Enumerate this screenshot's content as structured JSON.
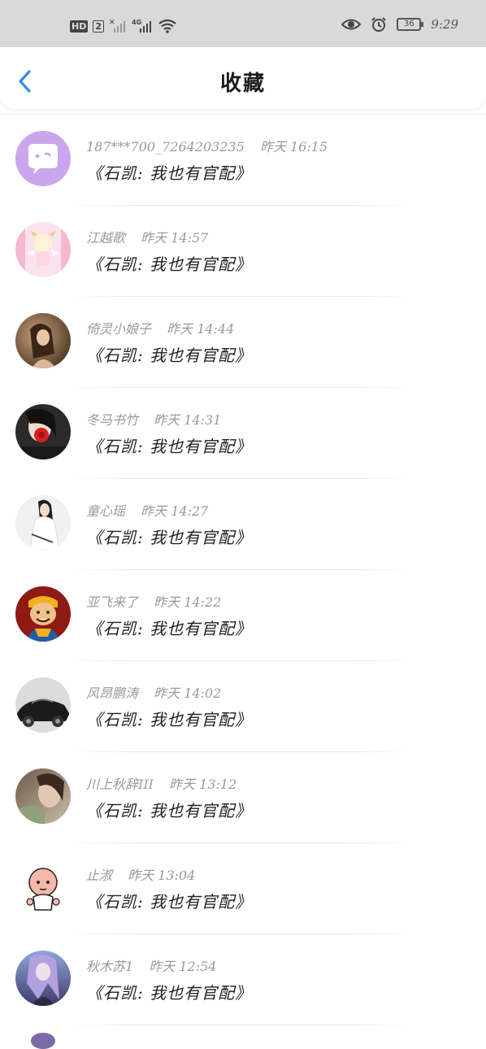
{
  "status_bar": {
    "hd_label": "HD",
    "sim_label": "2",
    "network_label": "4G",
    "battery_label": "36",
    "time": "9:29"
  },
  "header": {
    "back_icon": "chevron-left-icon",
    "title": "收藏",
    "accent_color": "#2e8ee6"
  },
  "favorites": [
    {
      "name": "187***700_7264203235",
      "time": "昨天 16:15",
      "title": "《石凯: 我也有官配》",
      "avatar": "purple-chat-bubble"
    },
    {
      "name": "江越歌",
      "time": "昨天 14:57",
      "title": "《石凯: 我也有官配》",
      "avatar": "pink-cartoon"
    },
    {
      "name": "倚灵小娘子",
      "time": "昨天 14:44",
      "title": "《石凯: 我也有官配》",
      "avatar": "girl-photo"
    },
    {
      "name": "冬马书竹",
      "time": "昨天 14:31",
      "title": "《石凯: 我也有官配》",
      "avatar": "girl-red-flower"
    },
    {
      "name": "童心瑶",
      "time": "昨天 14:27",
      "title": "《石凯: 我也有官配》",
      "avatar": "girl-white-dress"
    },
    {
      "name": "亚飞来了",
      "time": "昨天 14:22",
      "title": "《石凯: 我也有官配》",
      "avatar": "cartoon-monk"
    },
    {
      "name": "风昂鹏涛",
      "time": "昨天 14:02",
      "title": "《石凯: 我也有官配》",
      "avatar": "black-car"
    },
    {
      "name": "川上秋辞III",
      "time": "昨天 13:12",
      "title": "《石凯: 我也有官配》",
      "avatar": "blurry-photo"
    },
    {
      "name": "止淑",
      "time": "昨天 13:04",
      "title": "《石凯: 我也有官配》",
      "avatar": "cartoon-baby"
    },
    {
      "name": "秋木苏1",
      "time": "昨天 12:54",
      "title": "《石凯: 我也有官配》",
      "avatar": "anime-girl-purple"
    }
  ]
}
